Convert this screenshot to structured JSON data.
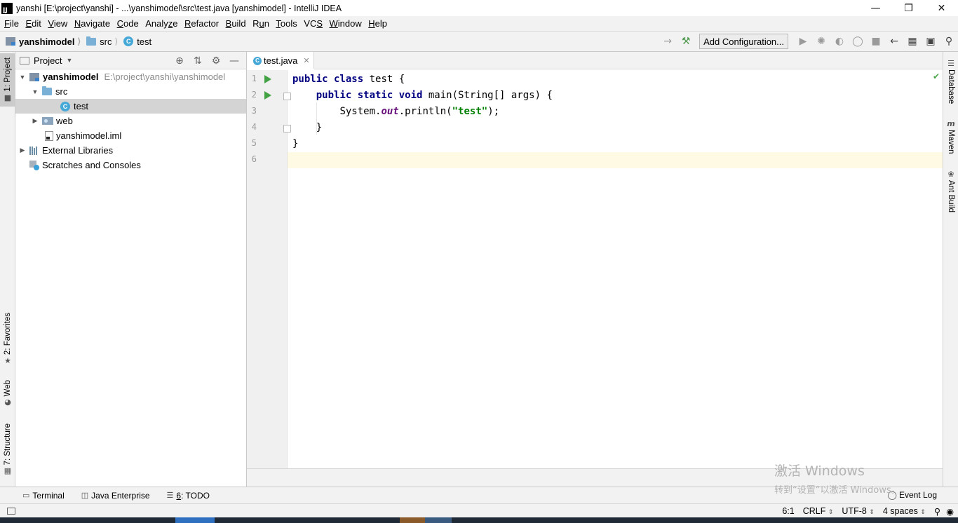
{
  "window": {
    "title": "yanshi [E:\\project\\yanshi] - ...\\yanshimodel\\src\\test.java [yanshimodel] - IntelliJ IDEA",
    "app_icon": "intellij-icon",
    "controls": [
      "minimize-icon",
      "restore-icon",
      "close-icon"
    ]
  },
  "menu": [
    {
      "mnemonic": "F",
      "rest": "ile"
    },
    {
      "mnemonic": "E",
      "rest": "dit"
    },
    {
      "mnemonic": "V",
      "rest": "iew"
    },
    {
      "mnemonic": "N",
      "rest": "avigate"
    },
    {
      "mnemonic": "C",
      "rest": "ode"
    },
    {
      "pre": "Analy",
      "mnemonic": "z",
      "rest": "e"
    },
    {
      "mnemonic": "R",
      "rest": "efactor"
    },
    {
      "mnemonic": "B",
      "rest": "uild"
    },
    {
      "pre": "R",
      "mnemonic": "u",
      "rest": "n"
    },
    {
      "mnemonic": "T",
      "rest": "ools"
    },
    {
      "pre": "VC",
      "mnemonic": "S",
      "rest": ""
    },
    {
      "mnemonic": "W",
      "rest": "indow"
    },
    {
      "mnemonic": "H",
      "rest": "elp"
    }
  ],
  "breadcrumb": {
    "module": "yanshimodel",
    "folder": "src",
    "file": "test"
  },
  "toolbar": {
    "add_configuration": "Add Configuration...",
    "icons": [
      "arrow-right-icon",
      "build-hammer-icon",
      "run-icon",
      "debug-icon",
      "coverage-icon",
      "profile-icon",
      "stop-icon",
      "back-arrow-icon",
      "project-structure-icon",
      "layout-icon",
      "search-icon"
    ]
  },
  "left_stripe": {
    "project": "1: Project",
    "favorites": "2: Favorites",
    "web": "Web",
    "structure": "7: Structure"
  },
  "right_stripe": {
    "database": "Database",
    "maven": "Maven",
    "maven_icon_letter": "m",
    "ant": "Ant Build"
  },
  "project_panel": {
    "title": "Project",
    "tree": {
      "root_name": "yanshimodel",
      "root_path": "E:\\project\\yanshi\\yanshimodel",
      "src": "src",
      "test": "test",
      "web": "web",
      "iml": "yanshimodel.iml",
      "libraries": "External Libraries",
      "scratches": "Scratches and Consoles"
    }
  },
  "editor": {
    "tab": "test.java",
    "class_icon_letter": "C",
    "line_numbers": [
      "1",
      "2",
      "3",
      "4",
      "5",
      "6"
    ],
    "code": {
      "l1_kw": "public class",
      "l1_rest": " test {",
      "l2_kw": "public static void",
      "l2_rest": " main(String[] args) {",
      "l3_a": "System.",
      "l3_field": "out",
      "l3_b": ".println(",
      "l3_str": "\"test\"",
      "l3_c": ");",
      "l4": "}",
      "l5": "}"
    },
    "current_line": 6
  },
  "bottom_tools": {
    "terminal": "Terminal",
    "java_enterprise": "Java Enterprise",
    "todo_mnemonic": "6",
    "todo_rest": ": TODO",
    "event_log": "Event Log"
  },
  "status": {
    "position": "6:1",
    "line_sep": "CRLF",
    "encoding": "UTF-8",
    "indent": "4 spaces"
  },
  "watermark": {
    "line1": "激活 Windows",
    "line2": "转到“设置”以激活 Windows。"
  },
  "colors": {
    "keyword": "#000080",
    "string": "#008000",
    "field": "#660e7a",
    "run_green": "#42a142",
    "current_line": "#fffae3",
    "selection": "#d4d4d4"
  }
}
